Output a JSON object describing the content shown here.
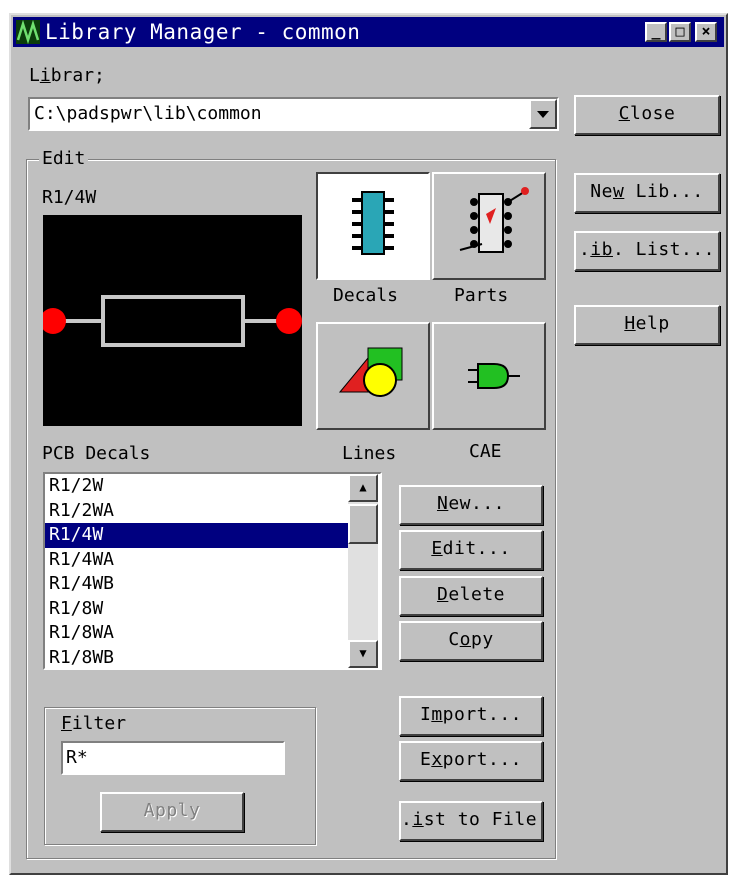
{
  "window": {
    "title": "Library Manager - common",
    "minimize": "_",
    "maximize": "□",
    "close": "×"
  },
  "library": {
    "label_pre": "L",
    "label_u": "i",
    "label_post": "brar;",
    "path": "C:\\padspwr\\lib\\common"
  },
  "buttons": {
    "close": {
      "pre": "",
      "u": "C",
      "post": "lose"
    },
    "new_lib": {
      "pre": "Ne",
      "u": "w",
      "post": " Lib..."
    },
    "lib_list": {
      "pre": ".",
      "u": "ib",
      "post": ". List..."
    },
    "help": {
      "pre": "",
      "u": "H",
      "post": "elp"
    },
    "new": {
      "pre": "",
      "u": "N",
      "post": "ew..."
    },
    "edit": {
      "pre": "",
      "u": "E",
      "post": "dit..."
    },
    "delete": {
      "pre": "",
      "u": "D",
      "post": "elete"
    },
    "copy": {
      "pre": "C",
      "u": "o",
      "post": "py"
    },
    "import": {
      "pre": "I",
      "u": "m",
      "post": "port..."
    },
    "export": {
      "pre": "E",
      "u": "x",
      "post": "port..."
    },
    "list_to_file": {
      "pre": ".",
      "u": "i",
      "post": "st to File"
    },
    "apply": {
      "pre": "Apply",
      "u": "",
      "post": ""
    }
  },
  "edit_group": {
    "label": "Edit",
    "preview_name": "R1/4W",
    "tools": {
      "decals": "Decals",
      "parts": "Parts",
      "lines": "Lines",
      "cae": "CAE"
    }
  },
  "decals": {
    "label": "PCB Decals",
    "items": [
      "R1/2W",
      "R1/2WA",
      "R1/4W",
      "R1/4WA",
      "R1/4WB",
      "R1/8W",
      "R1/8WA",
      "R1/8WB"
    ],
    "selected_index": 2
  },
  "filter": {
    "label_u": "F",
    "label_post": "ilter",
    "value": "R*"
  },
  "colors": {
    "title_bar": "#000080",
    "face": "#c0c0c0",
    "selection": "#000080",
    "pad_red": "#ff0000",
    "preview_bg": "#000000"
  }
}
